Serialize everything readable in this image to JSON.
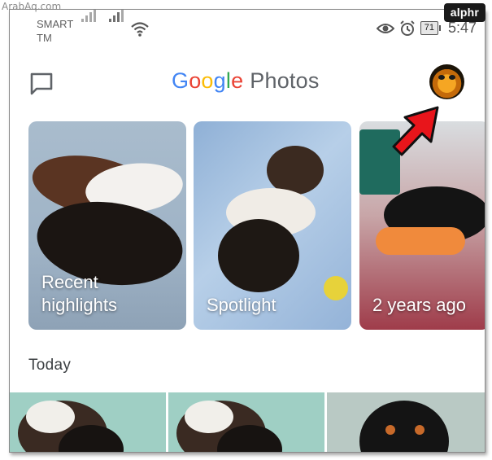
{
  "watermark": "ArabAq.com",
  "brand_badge": "alphr",
  "status_bar": {
    "carrier_line1": "SMART",
    "carrier_line2": "TM",
    "battery": "71",
    "time": "5:47",
    "icons": [
      "signal-weak-icon",
      "signal-icon",
      "wifi-icon",
      "eye-icon",
      "alarm-icon",
      "battery-icon"
    ]
  },
  "header": {
    "logo_letters": [
      {
        "char": "G",
        "color": "#4285F4"
      },
      {
        "char": "o",
        "color": "#EA4335"
      },
      {
        "char": "o",
        "color": "#FBBC05"
      },
      {
        "char": "g",
        "color": "#4285F4"
      },
      {
        "char": "l",
        "color": "#34A853"
      },
      {
        "char": "e",
        "color": "#EA4335"
      }
    ],
    "product": "Photos",
    "left_icon": "chat-icon",
    "right_icon": "account-avatar"
  },
  "memories": [
    {
      "label_line1": "Recent",
      "label_line2": "highlights"
    },
    {
      "label_line1": "Spotlight",
      "label_line2": ""
    },
    {
      "label_line1": "2 years ago",
      "label_line2": ""
    }
  ],
  "section": {
    "title": "Today"
  },
  "annotation": {
    "type": "red-arrow",
    "color": "#e8151b",
    "points_to": "account-avatar"
  }
}
